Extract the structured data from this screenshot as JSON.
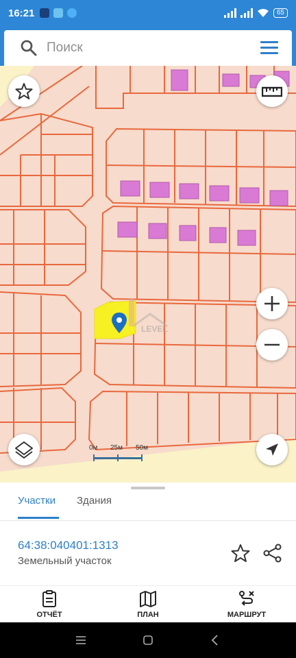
{
  "status_bar": {
    "time": "16:21",
    "battery": "65"
  },
  "search": {
    "placeholder": "Поиск"
  },
  "map": {
    "scale_labels": [
      "0м",
      "25м",
      "50м"
    ],
    "watermark_text": "LEVEL",
    "colors": {
      "ground": "#f7dbcc",
      "plot_border": "#e8683d",
      "building": "#d97ad4",
      "selected_parcel": "#f7f022",
      "road": "#fbf2c8"
    }
  },
  "sheet": {
    "tabs": [
      {
        "label": "Участки",
        "active": true
      },
      {
        "label": "Здания",
        "active": false
      }
    ],
    "parcel_number": "64:38:040401:1313",
    "parcel_type": "Земельный участок"
  },
  "actions": [
    {
      "label": "ОТЧЁТ",
      "icon": "report-icon"
    },
    {
      "label": "ПЛАН",
      "icon": "map-plan-icon"
    },
    {
      "label": "МАРШРУТ",
      "icon": "route-icon"
    }
  ]
}
